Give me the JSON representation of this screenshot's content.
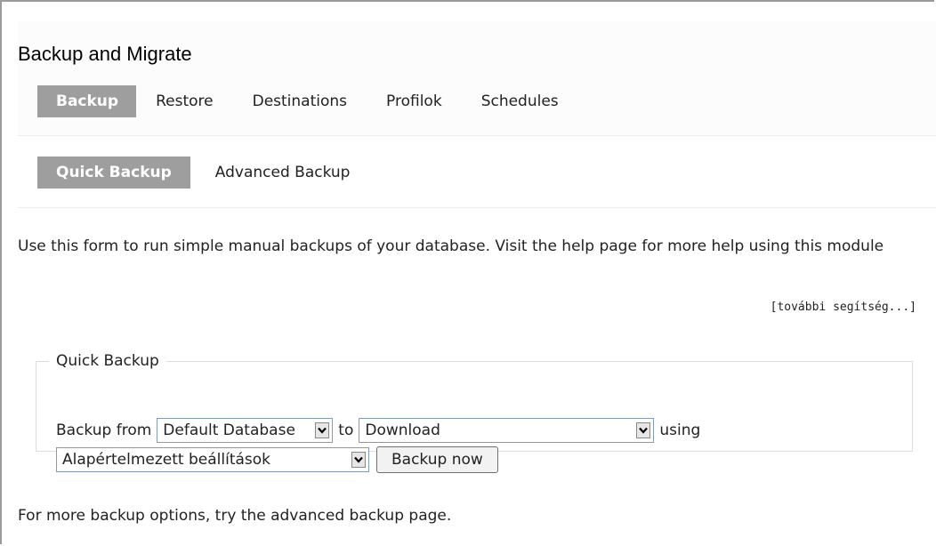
{
  "page": {
    "title": "Backup and Migrate"
  },
  "tabs": [
    {
      "label": "Backup",
      "active": true
    },
    {
      "label": "Restore",
      "active": false
    },
    {
      "label": "Destinations",
      "active": false
    },
    {
      "label": "Profilok",
      "active": false
    },
    {
      "label": "Schedules",
      "active": false
    }
  ],
  "subtabs": [
    {
      "label": "Quick Backup",
      "active": true
    },
    {
      "label": "Advanced Backup",
      "active": false
    }
  ],
  "intro": "Use this form to run simple manual backups of your database. Visit the help page for more help using this module",
  "more_help": "[további segítség...]",
  "quick_backup": {
    "legend": "Quick Backup",
    "backup_from_label": "Backup from",
    "source_value": "Default Database",
    "to_label": "to",
    "destination_value": "Download",
    "using_label": "using",
    "profile_value": "Alapértelmezett beállítások",
    "submit_label": "Backup now"
  },
  "footer_note": "For more backup options, try the advanced backup page.",
  "colors": {
    "active_tab_bg": "#9e9e9e",
    "active_tab_text": "#ffffff",
    "select_border": "#7f9db9"
  },
  "icons": {
    "select_arrow": "chevron-down-icon"
  }
}
